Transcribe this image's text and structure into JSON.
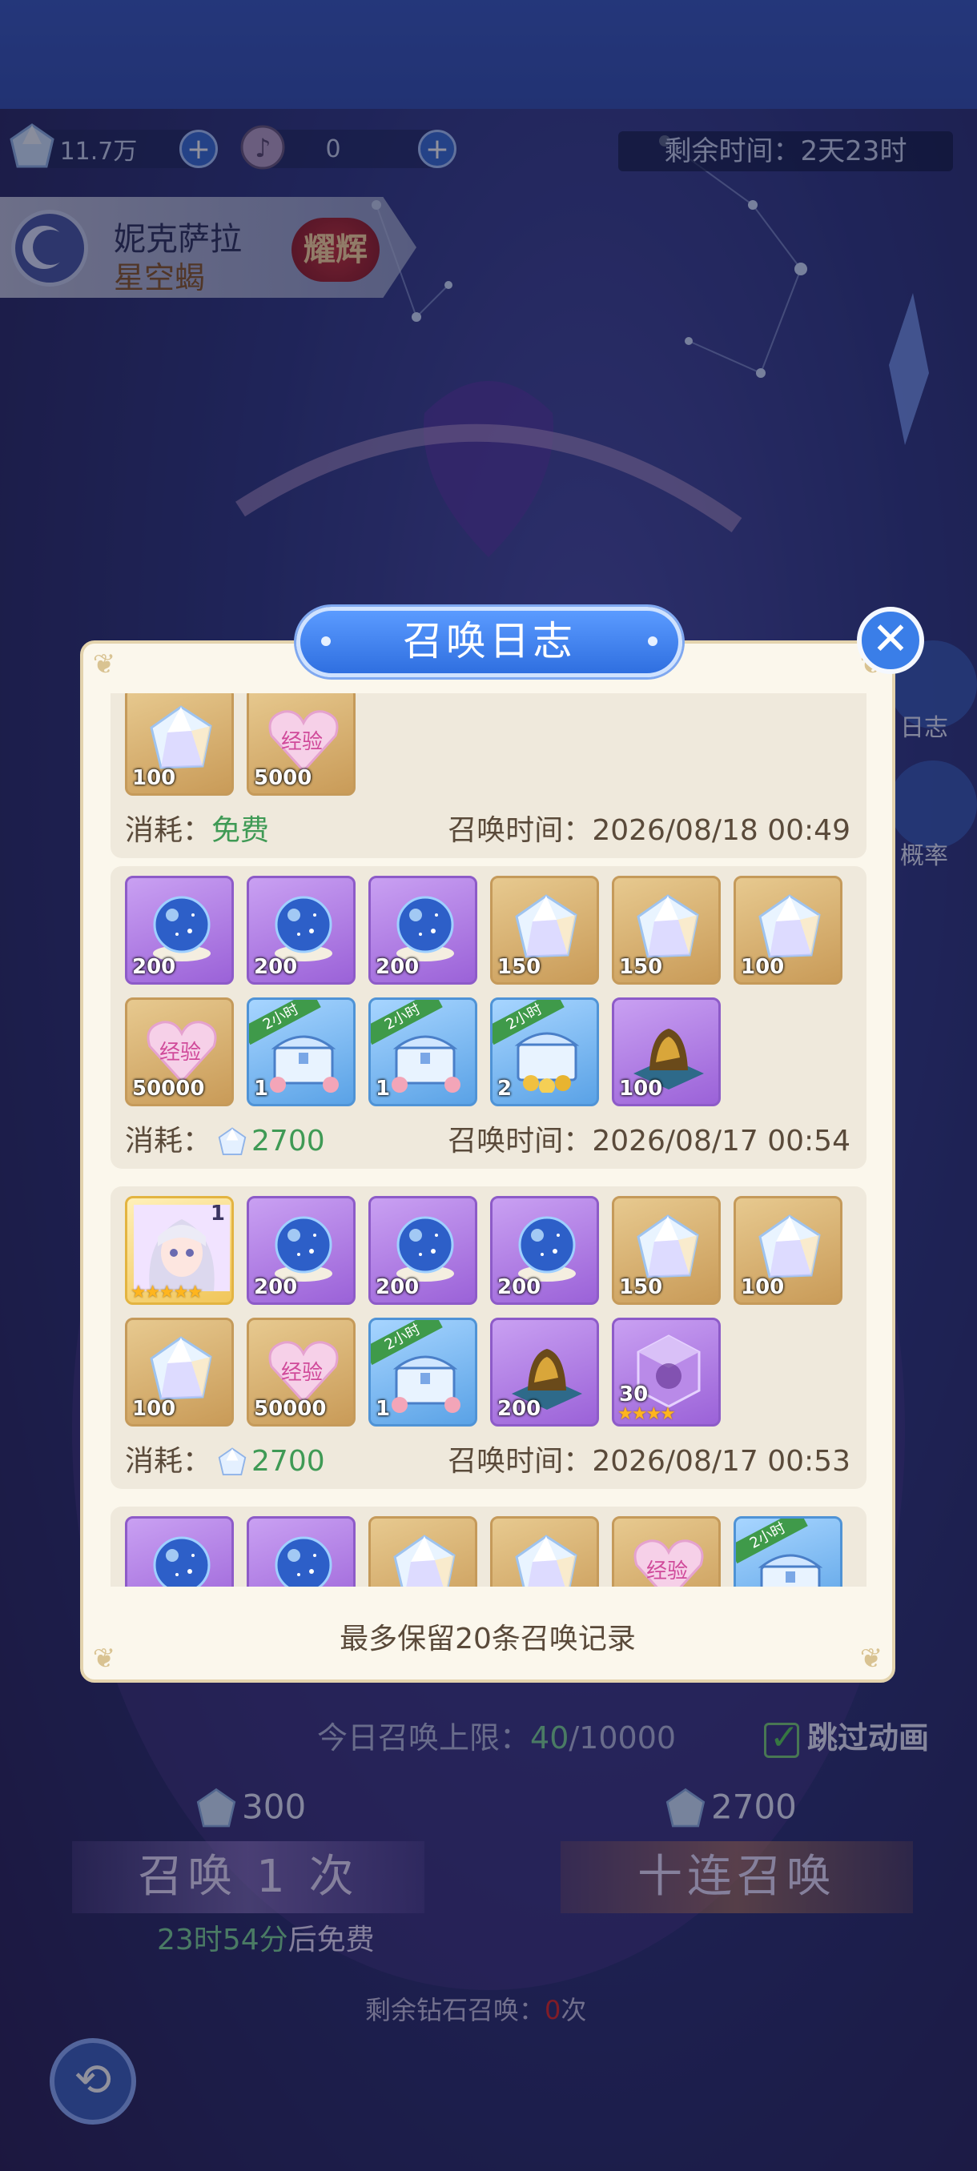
{
  "resources": {
    "crystals": "11.7万",
    "tickets": "0"
  },
  "timer": "剩余时间：2天23时",
  "character": {
    "name": "妮克萨拉",
    "title": "星空蝎",
    "badge": "耀辉"
  },
  "dialog": {
    "title": "召唤日志",
    "footer": "最多保留20条召唤记录",
    "cost_label": "消耗：",
    "time_label": "召唤时间：",
    "entries": [
      {
        "cost": "免费",
        "time": "2026/08/18 00:49",
        "items": [
          {
            "type": "crystal",
            "qty": "100",
            "color": "gold"
          },
          {
            "type": "exp",
            "qty": "5000",
            "color": "gold"
          }
        ]
      },
      {
        "cost": "2700",
        "time": "2026/08/17 00:54",
        "items": [
          {
            "type": "orb",
            "qty": "200",
            "color": "purple"
          },
          {
            "type": "orb",
            "qty": "200",
            "color": "purple"
          },
          {
            "type": "orb",
            "qty": "200",
            "color": "purple"
          },
          {
            "type": "crystal",
            "qty": "150",
            "color": "gold"
          },
          {
            "type": "crystal",
            "qty": "150",
            "color": "gold"
          },
          {
            "type": "crystal",
            "qty": "100",
            "color": "gold"
          },
          {
            "type": "exp",
            "qty": "50000",
            "color": "gold"
          },
          {
            "type": "chest",
            "qty": "1",
            "color": "blue",
            "tag": "2小时"
          },
          {
            "type": "chest",
            "qty": "1",
            "color": "blue",
            "tag": "2小时"
          },
          {
            "type": "chest-gold",
            "qty": "2",
            "color": "blue",
            "tag": "2小时"
          },
          {
            "type": "goldpile",
            "qty": "100",
            "color": "purple"
          }
        ]
      },
      {
        "cost": "2700",
        "time": "2026/08/17 00:53",
        "items": [
          {
            "type": "avatar",
            "qty": "",
            "count": "1",
            "color": "yellow",
            "stars": "★★★★★"
          },
          {
            "type": "orb",
            "qty": "200",
            "color": "purple"
          },
          {
            "type": "orb",
            "qty": "200",
            "color": "purple"
          },
          {
            "type": "orb",
            "qty": "200",
            "color": "purple"
          },
          {
            "type": "crystal",
            "qty": "150",
            "color": "gold"
          },
          {
            "type": "crystal",
            "qty": "100",
            "color": "gold"
          },
          {
            "type": "crystal",
            "qty": "100",
            "color": "gold"
          },
          {
            "type": "exp",
            "qty": "50000",
            "color": "gold"
          },
          {
            "type": "chest",
            "qty": "1",
            "color": "blue",
            "tag": "2小时"
          },
          {
            "type": "goldpile",
            "qty": "200",
            "color": "purple"
          },
          {
            "type": "cube",
            "qty": "30",
            "color": "purple",
            "stars": "★★★★"
          }
        ]
      },
      {
        "cost": "",
        "time": "",
        "items": [
          {
            "type": "orb",
            "qty": "",
            "color": "purple"
          },
          {
            "type": "orb",
            "qty": "",
            "color": "purple"
          },
          {
            "type": "crystal",
            "qty": "",
            "color": "gold"
          },
          {
            "type": "crystal",
            "qty": "",
            "color": "gold"
          },
          {
            "type": "exp",
            "qty": "",
            "color": "gold"
          },
          {
            "type": "chest",
            "qty": "",
            "color": "blue",
            "tag": "2小时"
          }
        ]
      }
    ]
  },
  "summon": {
    "limit_prefix": "今日召唤上限：",
    "limit_used": "40",
    "limit_total": "/10000",
    "skip_label": "跳过动画",
    "single_cost": "300",
    "ten_cost": "2700",
    "single_label": "召唤 1 次",
    "ten_label": "十连召唤",
    "free_time": "23时54分",
    "free_suffix": "后免费",
    "remain_prefix": "剩余钻石召唤：",
    "remain_count": "0",
    "remain_suffix": "次"
  },
  "side": {
    "log_label": "日志",
    "rate_label": "概率"
  },
  "colors": {
    "accent_blue": "#2f6fe0",
    "free_green": "#3f9a55",
    "gold_frame": "#c59a5a",
    "purple_frame": "#8d5bc8"
  }
}
